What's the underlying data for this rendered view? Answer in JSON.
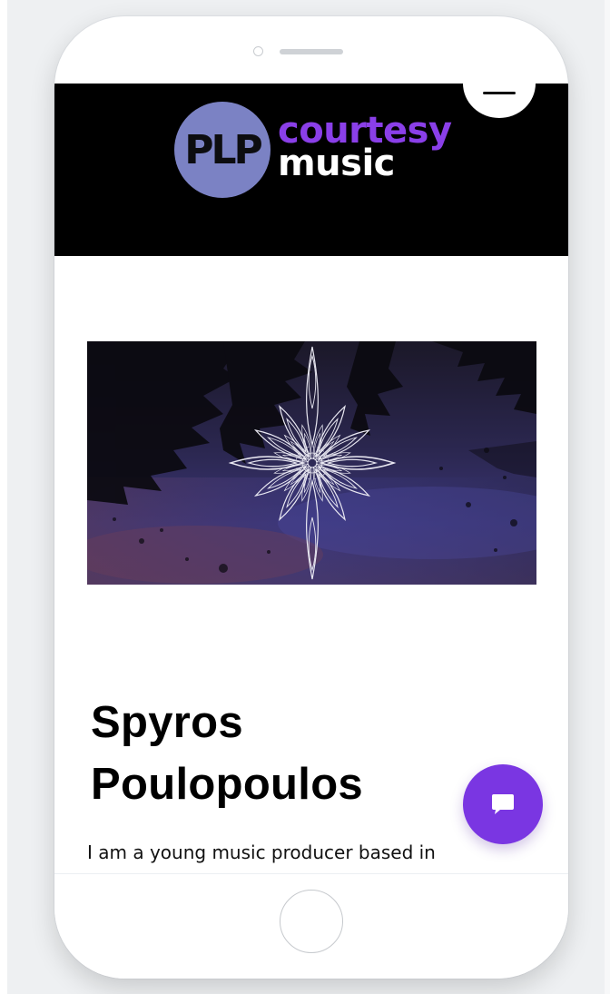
{
  "header": {
    "logo_monogram": "PLP",
    "logo_word_1": "courtesy",
    "logo_word_2": "music",
    "menu_icon": "hamburger-icon"
  },
  "hero": {
    "icon": "mandala-ornament"
  },
  "artist": {
    "name": "Spyros Poulopoulos",
    "bio_preview": "I am a young music producer based in"
  },
  "chat": {
    "icon": "chat-bubble-icon"
  },
  "colors": {
    "header_bg": "#000000",
    "accent": "#7a36e2",
    "logo_circle": "#7b82c4",
    "logo_purple": "#8a3fe8"
  }
}
